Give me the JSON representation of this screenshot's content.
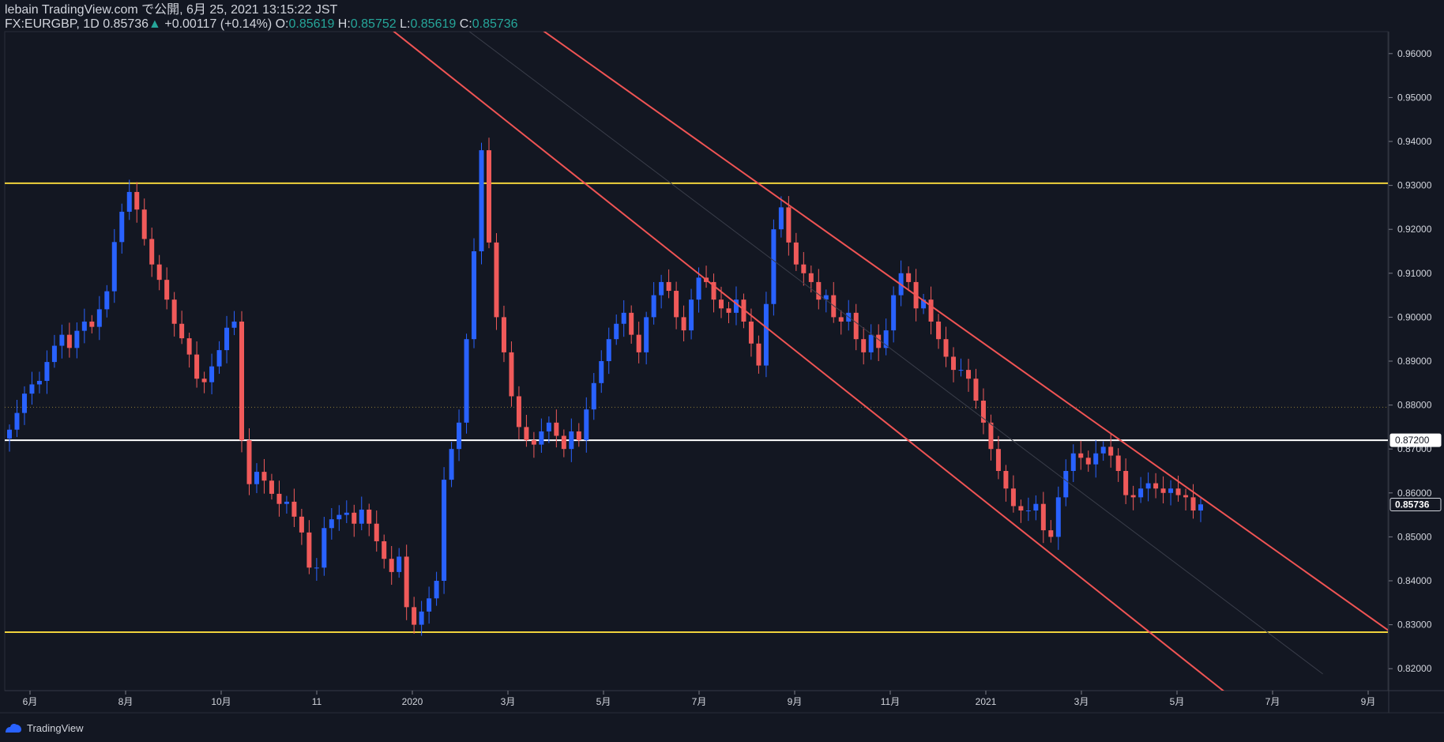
{
  "header": {
    "published": "lebain TradingView.com で公開, 6月 25, 2021 13:15:22 JST",
    "symbol": "FX:EURGBP, 1D",
    "last": "0.85736",
    "change": "+0.00117 (+0.14%)",
    "o_label": "O:",
    "o": "0.85619",
    "h_label": "H:",
    "h": "0.85752",
    "l_label": "L:",
    "l": "0.85619",
    "c_label": "C:",
    "c": "0.85736"
  },
  "footer": {
    "brand": "TradingView"
  },
  "colors": {
    "background": "#131722",
    "up": "#2962ff",
    "down": "#f05a5a",
    "support_resistance": "#f0d23c",
    "channel": "#f05454",
    "level": "#ffffff",
    "text": "#d1d4dc"
  },
  "chart_data": {
    "type": "candlestick",
    "symbol": "FX:EURGBP",
    "interval": "1D",
    "ylim": [
      0.815,
      0.965
    ],
    "y_ticks": [
      "0.82000",
      "0.83000",
      "0.84000",
      "0.85000",
      "0.86000",
      "0.87000",
      "0.88000",
      "0.89000",
      "0.90000",
      "0.91000",
      "0.92000",
      "0.93000",
      "0.94000",
      "0.95000",
      "0.96000"
    ],
    "x_ticks": [
      "6月",
      "8月",
      "10月",
      "11",
      "2020",
      "3月",
      "5月",
      "7月",
      "9月",
      "11月",
      "2021",
      "3月",
      "5月",
      "7月",
      "9月"
    ],
    "price_labels": [
      {
        "text": "0.87200",
        "value": 0.872,
        "style": "white"
      },
      {
        "text": "0.85736",
        "value": 0.85736,
        "style": "last"
      }
    ],
    "horizontal_lines": [
      {
        "name": "resistance",
        "value": 0.9305,
        "color": "#f0d23c"
      },
      {
        "name": "level",
        "value": 0.872,
        "color": "#ffffff"
      },
      {
        "name": "support",
        "value": 0.8283,
        "color": "#f0d23c"
      },
      {
        "name": "dotted-level",
        "value": 0.8795,
        "color": "#8a7a3a"
      }
    ],
    "closes": [
      0.8744,
      0.8782,
      0.8826,
      0.8847,
      0.8855,
      0.8898,
      0.8935,
      0.896,
      0.893,
      0.8969,
      0.899,
      0.8978,
      0.9018,
      0.9059,
      0.9171,
      0.924,
      0.9285,
      0.9245,
      0.9178,
      0.912,
      0.9085,
      0.904,
      0.8985,
      0.8952,
      0.8915,
      0.886,
      0.8852,
      0.8888,
      0.8925,
      0.8976,
      0.899,
      0.872,
      0.862,
      0.8648,
      0.8628,
      0.8598,
      0.8575,
      0.858,
      0.8546,
      0.851,
      0.843,
      0.843,
      0.852,
      0.854,
      0.855,
      0.8555,
      0.853,
      0.8562,
      0.853,
      0.849,
      0.845,
      0.842,
      0.8455,
      0.834,
      0.83,
      0.833,
      0.836,
      0.84,
      0.863,
      0.87,
      0.876,
      0.895,
      0.915,
      0.938,
      0.917,
      0.9,
      0.892,
      0.882,
      0.875,
      0.872,
      0.871,
      0.874,
      0.876,
      0.873,
      0.87,
      0.874,
      0.872,
      0.879,
      0.885,
      0.89,
      0.895,
      0.8985,
      0.901,
      0.896,
      0.892,
      0.9,
      0.905,
      0.908,
      0.906,
      0.9,
      0.897,
      0.904,
      0.909,
      0.908,
      0.904,
      0.902,
      0.901,
      0.904,
      0.899,
      0.894,
      0.889,
      0.903,
      0.92,
      0.925,
      0.917,
      0.912,
      0.91,
      0.908,
      0.904,
      0.905,
      0.9,
      0.899,
      0.901,
      0.895,
      0.892,
      0.896,
      0.893,
      0.897,
      0.905,
      0.91,
      0.908,
      0.902,
      0.904,
      0.899,
      0.895,
      0.891,
      0.888,
      0.888,
      0.886,
      0.881,
      0.876,
      0.87,
      0.865,
      0.861,
      0.857,
      0.856,
      0.856,
      0.8575,
      0.8515,
      0.85,
      0.859,
      0.865,
      0.869,
      0.868,
      0.8665,
      0.869,
      0.8705,
      0.8685,
      0.865,
      0.8595,
      0.859,
      0.861,
      0.8622,
      0.861,
      0.86,
      0.861,
      0.8595,
      0.859,
      0.856,
      0.8574
    ],
    "trendlines": [
      {
        "name": "channel-lower",
        "p1": {
          "idx": 48.3,
          "price": 0.9691
        },
        "p2": {
          "idx": 164.5,
          "price": 0.8116
        },
        "color": "#f05454"
      },
      {
        "name": "channel-upper",
        "p1": {
          "idx": 68.0,
          "price": 0.9691
        },
        "p2": {
          "idx": 186.2,
          "price": 0.8261
        },
        "color": "#f05454"
      },
      {
        "name": "channel-mid",
        "p1": {
          "idx": 58.2,
          "price": 0.9691
        },
        "p2": {
          "idx": 175.3,
          "price": 0.8188
        },
        "color": "#3a3e4a"
      }
    ]
  }
}
